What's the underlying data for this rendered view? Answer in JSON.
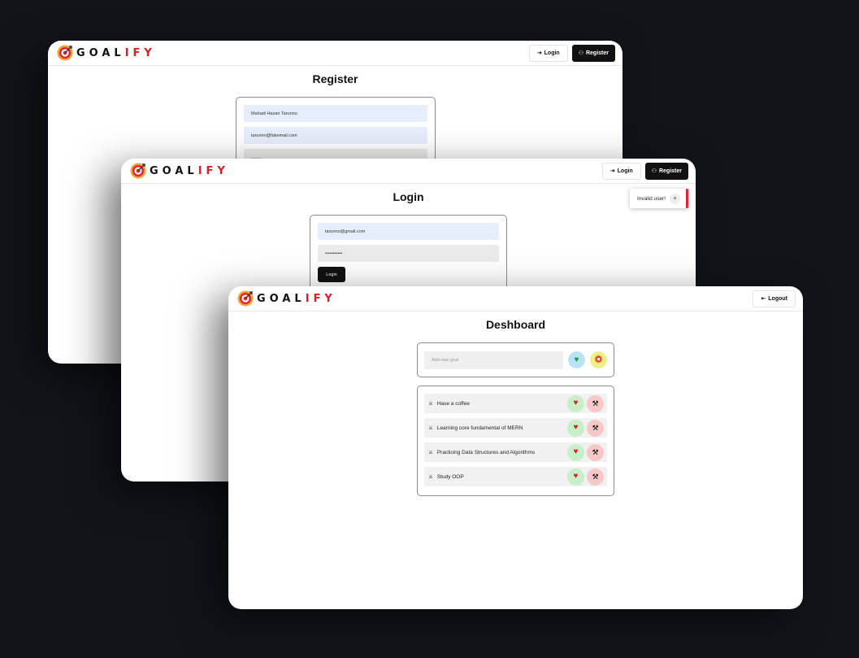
{
  "brand": {
    "prefix": "GOAL",
    "suffix": "IFY",
    "accent_color": "#d61f26"
  },
  "nav": {
    "login_label": "Login",
    "register_label": "Register",
    "logout_label": "Logout"
  },
  "register": {
    "title": "Register",
    "name_value": "Mahadi Hasan Tarunno",
    "email_value": "tarunno@fakemail.com",
    "password_value": "........"
  },
  "login": {
    "title": "Login",
    "email_value": "tarunno@gmail.com",
    "password_value": "•••••••••••",
    "submit_label": "Login",
    "toast_message": "Invalid user!",
    "toast_close": "×"
  },
  "dashboard": {
    "title": "Deshboard",
    "new_goal_placeholder": "Add new goal",
    "goals": [
      {
        "label": "Have a coffee"
      },
      {
        "label": "Learning core fundamental of MERN"
      },
      {
        "label": "Practicing Data Structures and Algorithms"
      },
      {
        "label": "Study OOP"
      }
    ]
  }
}
